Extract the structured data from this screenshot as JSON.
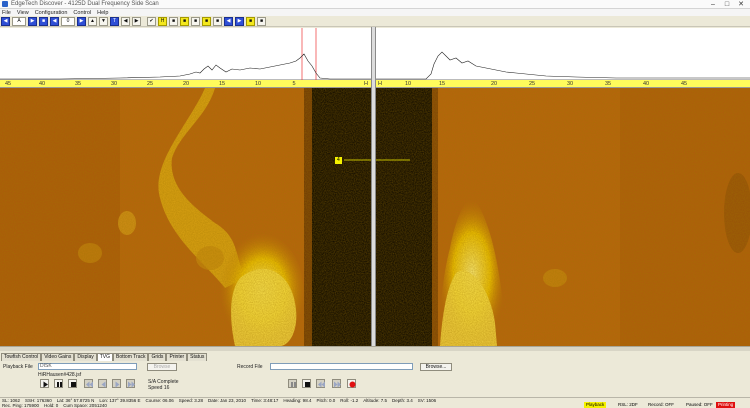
{
  "window": {
    "title": "EdgeTech  Discover - 4125D  Dual Frequency Side Scan"
  },
  "menu": [
    "File",
    "View",
    "Configuration",
    "Control",
    "Help"
  ],
  "toolbar": {
    "buttons": [
      "◀",
      "A",
      "▶",
      "■",
      "◀",
      "▶",
      "0",
      "▲",
      "▼",
      "T",
      "◀",
      "▶",
      "✔",
      "H",
      "■",
      "■",
      "■",
      "■",
      "■",
      "◀",
      "▶",
      "■",
      "■"
    ]
  },
  "scale": {
    "left_ticks": [
      "45",
      "40",
      "35",
      "30",
      "25",
      "20",
      "15",
      "10",
      "5"
    ],
    "left_end": "H",
    "right_ticks": [
      "10",
      "15",
      "20",
      "25",
      "30",
      "35",
      "40",
      "45"
    ],
    "right_start": "H"
  },
  "sonar": {
    "marker_badge": "4"
  },
  "tabs": [
    "Towfish Control",
    "Video Gains",
    "Display",
    "TVG",
    "Bottom Track",
    "Grids",
    "Printer",
    "Status"
  ],
  "playback": {
    "label": "Playback File",
    "value": "DISK",
    "browse_label": "Browse",
    "filename": "HiRHausen#428.jsf",
    "status": "S/A Complete",
    "speed_label": "Speed",
    "speed_value": "16"
  },
  "record": {
    "label": "Record File",
    "value": "",
    "browse_label": "Browse..."
  },
  "status": {
    "line1": [
      "SL: 1062",
      "SSH: 176360",
      "Lat:  36° 57.8725 N",
      "Lon:  137° 39.8356 E",
      "Course: 06.06",
      "Speed: 3.28",
      "Date: Jan 23, 2010",
      "Time: 3:48:17",
      "Heading: 98.4",
      "Pitch: 0.0",
      "Roll: -1.2",
      "Altitude: 7.5",
      "Depth: 3.4",
      "SV: 1506"
    ],
    "line2": [
      "Rec. Ping: 175900",
      "Hold: 0",
      "Cum Space: 2051240"
    ],
    "indicators": [
      "Playback",
      "RSL: 2DF",
      "Record: OFF",
      "Paused: OFF",
      "Printing"
    ]
  },
  "colors": {
    "sonar_bg": "#b55f0c",
    "sonar_bright": "#f4d600",
    "scale_yellow": "#fffb5c",
    "accent_blue": "#2f4fd6",
    "record_red": "#e01010"
  }
}
